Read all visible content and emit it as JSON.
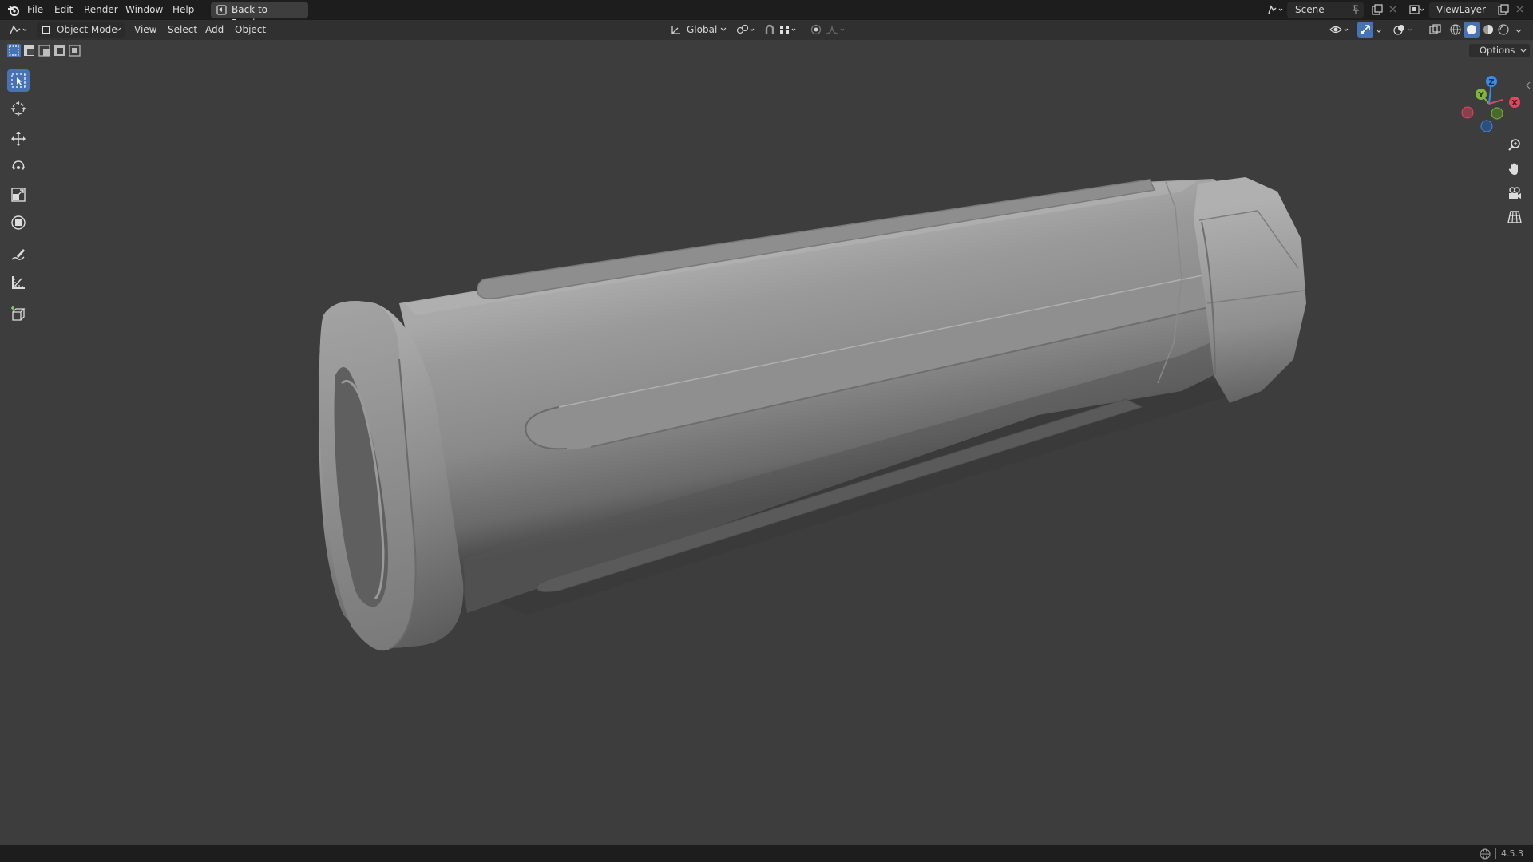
{
  "topbar": {
    "menus": [
      "File",
      "Edit",
      "Render",
      "Window",
      "Help"
    ],
    "back_button": "Back to Previous",
    "scene_label": "Scene",
    "viewlayer_label": "ViewLayer"
  },
  "header": {
    "mode": "Object Mode",
    "menus": [
      "View",
      "Select",
      "Add",
      "Object"
    ],
    "orientation": "Global",
    "options_label": "Options"
  },
  "toolbar": {
    "tools": [
      "select-box",
      "cursor",
      "move",
      "rotate",
      "scale",
      "transform",
      "annotate",
      "measure",
      "add-cube"
    ],
    "active_tool": "select-box"
  },
  "gizmo": {
    "axes": {
      "x": "X",
      "y": "Y",
      "z": "Z"
    },
    "colors": {
      "x": "#e0475f",
      "y": "#82b53d",
      "z": "#3b8de8"
    }
  },
  "navigation": [
    "zoom-icon",
    "hand-icon",
    "camera-icon",
    "grid-icon"
  ],
  "statusbar": {
    "version": "4.5.3"
  },
  "colors": {
    "accent": "#4772b3",
    "viewport_bg": "#3d3d3d",
    "topbar_bg": "#1d1d1d"
  }
}
